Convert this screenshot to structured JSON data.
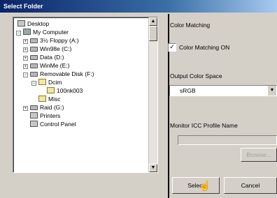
{
  "window": {
    "title": "Select Folder"
  },
  "tree": {
    "items": [
      {
        "label": "Desktop"
      },
      {
        "label": "My Computer"
      },
      {
        "label": "3½ Floppy (A:)"
      },
      {
        "label": "Win98e (C:)"
      },
      {
        "label": "Data (D:)"
      },
      {
        "label": "WinMe (E:)"
      },
      {
        "label": "Removable Disk (F:)"
      },
      {
        "label": "Dcim"
      },
      {
        "label": "100nk003"
      },
      {
        "label": "Misc"
      },
      {
        "label": "Raid (G:)"
      },
      {
        "label": "Printers"
      },
      {
        "label": "Control Panel"
      }
    ]
  },
  "panel": {
    "color_matching_label": "Color Matching",
    "color_matching_checkbox": "Color Matching ON",
    "output_color_space_label": "Output Color Space",
    "output_color_space_value": "sRGB",
    "monitor_profile_label": "Monitor ICC Profile Name",
    "browse_button": "Browse..."
  },
  "buttons": {
    "select": "Select",
    "cancel": "Cancel"
  }
}
